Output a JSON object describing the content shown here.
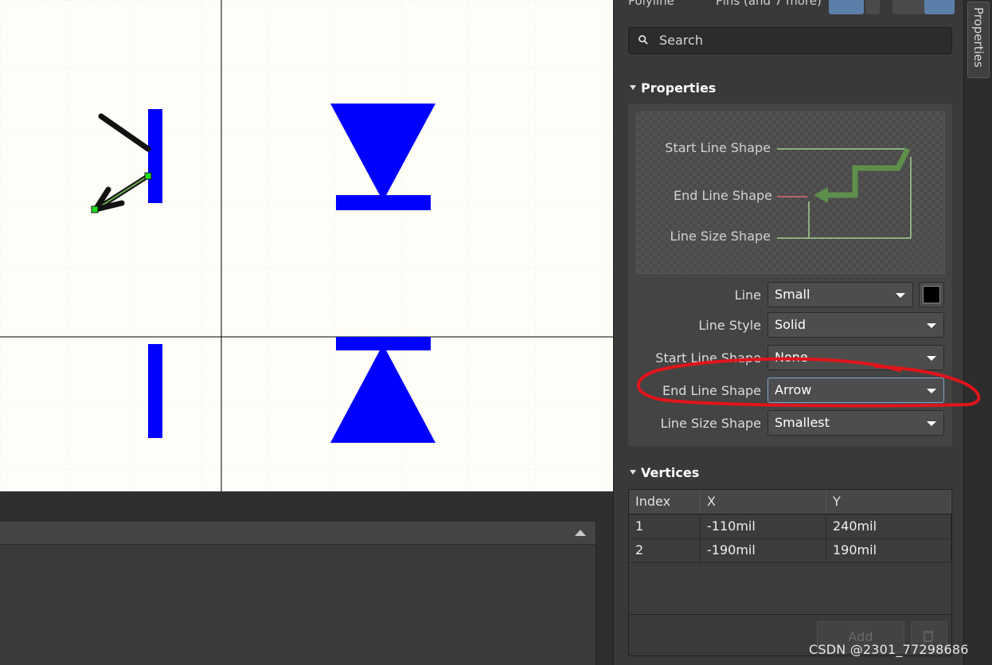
{
  "header": {
    "object_type": "Polyline",
    "filter_text": "Pins (and 7 more)"
  },
  "search": {
    "placeholder": "Search"
  },
  "properties": {
    "title": "Properties",
    "preview_labels": {
      "start": "Start Line Shape",
      "end": "End Line Shape",
      "size": "Line Size Shape"
    },
    "rows": [
      {
        "label": "Line",
        "value": "Small"
      },
      {
        "label": "Line Style",
        "value": "Solid"
      },
      {
        "label": "Start Line Shape",
        "value": "None"
      },
      {
        "label": "End Line Shape",
        "value": "Arrow"
      },
      {
        "label": "Line Size Shape",
        "value": "Smallest"
      }
    ],
    "line_color": "#000000"
  },
  "vertices": {
    "title": "Vertices",
    "columns": [
      "Index",
      "X",
      "Y"
    ],
    "rows": [
      {
        "index": "1",
        "x": "-110mil",
        "y": "240mil"
      },
      {
        "index": "2",
        "x": "-190mil",
        "y": "190mil"
      }
    ],
    "add_label": "Add"
  },
  "side_tab": {
    "label": "Properties"
  },
  "watermark": "CSDN @2301_77298686",
  "colors": {
    "pin_blue": "#0000ff",
    "highlight_red": "#e0151b",
    "canvas_bg": "#fffdf7"
  }
}
